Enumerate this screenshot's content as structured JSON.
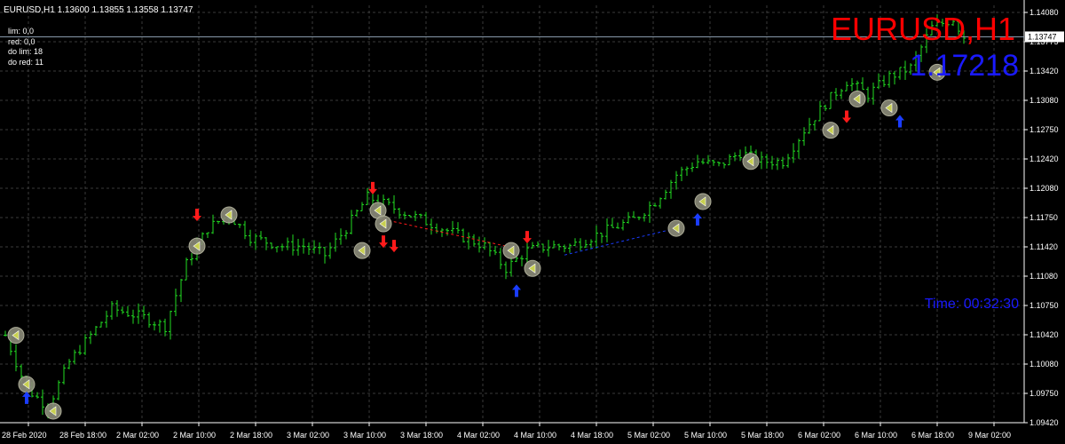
{
  "header": {
    "info": "EURUSD,H1  1.13600 1.13855 1.13558 1.13747",
    "stats": [
      "lim: 0,0",
      "red: 0,0",
      "do lim: 18",
      "do red: 11"
    ]
  },
  "overlay": {
    "symbol": "EURUSD,H1",
    "price": "1.17218",
    "timer": "Time: 00:32:30"
  },
  "colors": {
    "background": "#000000",
    "grid": "#3a3a3a",
    "bar": "#22dd22",
    "axis": "#ffffff",
    "sell": "#ff1a1a",
    "buy": "#1a3cff",
    "marker_fill": "#8c8c7a",
    "marker_glyph": "#c8d050"
  },
  "chart_data": {
    "type": "ohlc",
    "title": "EURUSD,H1",
    "ylim": [
      1.0942,
      1.141
    ],
    "y_ticks": [
      "1.14080",
      "1.13775",
      "1.13420",
      "1.13080",
      "1.12750",
      "1.12420",
      "1.12080",
      "1.11750",
      "1.11420",
      "1.11080",
      "1.10750",
      "1.10420",
      "1.10080",
      "1.09750",
      "1.09420"
    ],
    "current_price": "1.13747",
    "x_ticks": [
      "28 Feb 2020",
      "28 Feb 18:00",
      "2 Mar 02:00",
      "2 Mar 10:00",
      "2 Mar 18:00",
      "3 Mar 02:00",
      "3 Mar 10:00",
      "3 Mar 18:00",
      "4 Mar 02:00",
      "4 Mar 10:00",
      "4 Mar 18:00",
      "5 Mar 02:00",
      "5 Mar 10:00",
      "5 Mar 18:00",
      "6 Mar 02:00",
      "6 Mar 10:00",
      "6 Mar 18:00",
      "9 Mar 02:00"
    ],
    "path": [
      [
        0,
        1.104
      ],
      [
        4,
        1.098
      ],
      [
        8,
        1.096
      ],
      [
        12,
        1.101
      ],
      [
        16,
        1.104
      ],
      [
        20,
        1.107
      ],
      [
        26,
        1.106
      ],
      [
        30,
        1.105
      ],
      [
        34,
        1.112
      ],
      [
        38,
        1.116
      ],
      [
        42,
        1.1175
      ],
      [
        46,
        1.115
      ],
      [
        52,
        1.114
      ],
      [
        56,
        1.114
      ],
      [
        60,
        1.113
      ],
      [
        64,
        1.116
      ],
      [
        68,
        1.1195
      ],
      [
        72,
        1.1185
      ],
      [
        76,
        1.1175
      ],
      [
        82,
        1.116
      ],
      [
        86,
        1.115
      ],
      [
        90,
        1.114
      ],
      [
        94,
        1.1115
      ],
      [
        98,
        1.1135
      ],
      [
        102,
        1.114
      ],
      [
        106,
        1.114
      ],
      [
        110,
        1.115
      ],
      [
        114,
        1.116
      ],
      [
        118,
        1.117
      ],
      [
        122,
        1.119
      ],
      [
        126,
        1.122
      ],
      [
        130,
        1.1235
      ],
      [
        134,
        1.123
      ],
      [
        138,
        1.1245
      ],
      [
        142,
        1.1235
      ],
      [
        146,
        1.1235
      ],
      [
        150,
        1.127
      ],
      [
        154,
        1.13
      ],
      [
        158,
        1.1325
      ],
      [
        162,
        1.131
      ],
      [
        166,
        1.133
      ],
      [
        170,
        1.134
      ],
      [
        174,
        1.1385
      ],
      [
        178,
        1.1395
      ],
      [
        180,
        1.1375
      ]
    ],
    "sell_signals": [
      [
        36,
        1.1175
      ],
      [
        69,
        1.1205
      ],
      [
        71,
        1.1145
      ],
      [
        73,
        1.114
      ],
      [
        98,
        1.115
      ],
      [
        158,
        1.1285
      ]
    ],
    "buy_signals": [
      [
        4,
        1.097
      ],
      [
        96,
        1.109
      ],
      [
        130,
        1.117
      ],
      [
        168,
        1.128
      ]
    ],
    "close_markers": [
      [
        2,
        1.104
      ],
      [
        4,
        1.0985
      ],
      [
        9,
        1.0955
      ],
      [
        36,
        1.114
      ],
      [
        42,
        1.1175
      ],
      [
        67,
        1.1135
      ],
      [
        70,
        1.118
      ],
      [
        71,
        1.1165
      ],
      [
        95,
        1.1135
      ],
      [
        99,
        1.1115
      ],
      [
        126,
        1.116
      ],
      [
        131,
        1.119
      ],
      [
        140,
        1.1235
      ],
      [
        155,
        1.127
      ],
      [
        160,
        1.1305
      ],
      [
        166,
        1.1295
      ],
      [
        175,
        1.1335
      ]
    ],
    "dashed_lines": [
      {
        "color": "sell",
        "points": [
          [
            71,
            1.117
          ],
          [
            94,
            1.114
          ]
        ]
      },
      {
        "color": "buy",
        "points": [
          [
            105,
            1.113
          ],
          [
            126,
            1.116
          ]
        ]
      }
    ]
  }
}
